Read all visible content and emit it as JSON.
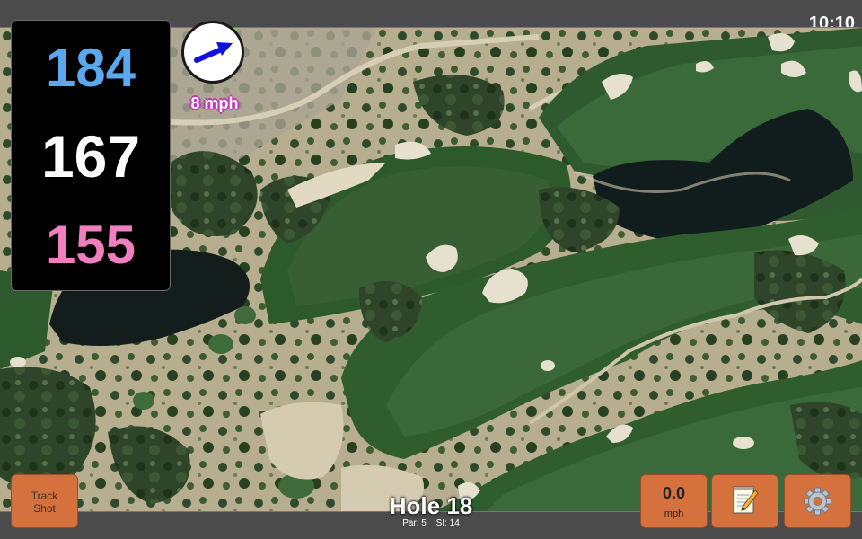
{
  "status_bar": {
    "time": "10:10"
  },
  "yardages": {
    "back": "184",
    "center": "167",
    "front": "155",
    "back_color": "#5aa8ee",
    "center_color": "#ffffff",
    "front_color": "#f07fbf"
  },
  "wind": {
    "speed": "8 mph",
    "direction_icon": "arrow-right-up-icon",
    "arrow_color": "#1010e0"
  },
  "buttons": {
    "track_shot_line1": "Track",
    "track_shot_line2": "Shot",
    "speed_value": "0.0",
    "speed_unit": "mph",
    "notes_icon": "notepad-pencil-icon",
    "settings_icon": "gear-icon",
    "accent": "#d4713c"
  },
  "hole": {
    "title": "Hole 18",
    "par": "Par: 5",
    "si": "SI: 14"
  }
}
